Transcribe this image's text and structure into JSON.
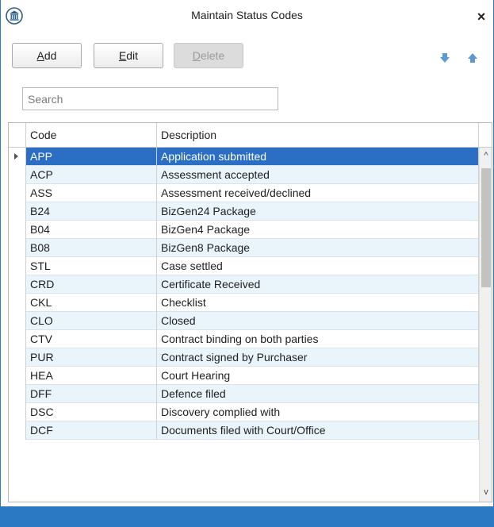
{
  "window": {
    "title": "Maintain Status Codes",
    "close_symbol": "×"
  },
  "colors": {
    "accent": "#2b79c2",
    "selected_row": "#2a6fc4",
    "alt_row": "#eaf4fb",
    "arrow_icon": "#5b9bd5"
  },
  "toolbar": {
    "add_mnemonic": "A",
    "add_rest": "dd",
    "edit_mnemonic": "E",
    "edit_rest": "dit",
    "delete_mnemonic": "D",
    "delete_rest": "elete",
    "move_down_icon": "arrow-down-icon",
    "move_up_icon": "arrow-up-icon"
  },
  "search": {
    "placeholder": "Search",
    "value": ""
  },
  "grid": {
    "columns": [
      "Code",
      "Description"
    ],
    "rows": [
      {
        "code": "APP",
        "description": "Application submitted"
      },
      {
        "code": "ACP",
        "description": "Assessment accepted"
      },
      {
        "code": "ASS",
        "description": "Assessment received/declined"
      },
      {
        "code": "B24",
        "description": "BizGen24 Package"
      },
      {
        "code": "B04",
        "description": "BizGen4 Package"
      },
      {
        "code": "B08",
        "description": "BizGen8 Package"
      },
      {
        "code": "STL",
        "description": "Case settled"
      },
      {
        "code": "CRD",
        "description": "Certificate Received"
      },
      {
        "code": "CKL",
        "description": "Checklist"
      },
      {
        "code": "CLO",
        "description": "Closed"
      },
      {
        "code": "CTV",
        "description": "Contract binding on both parties"
      },
      {
        "code": "PUR",
        "description": "Contract signed by Purchaser"
      },
      {
        "code": "HEA",
        "description": "Court Hearing"
      },
      {
        "code": "DFF",
        "description": "Defence filed"
      },
      {
        "code": "DSC",
        "description": "Discovery complied with"
      },
      {
        "code": "DCF",
        "description": "Documents filed with Court/Office"
      }
    ],
    "selected_index": 0,
    "scroll_up_symbol": "^",
    "scroll_down_symbol": "v"
  }
}
